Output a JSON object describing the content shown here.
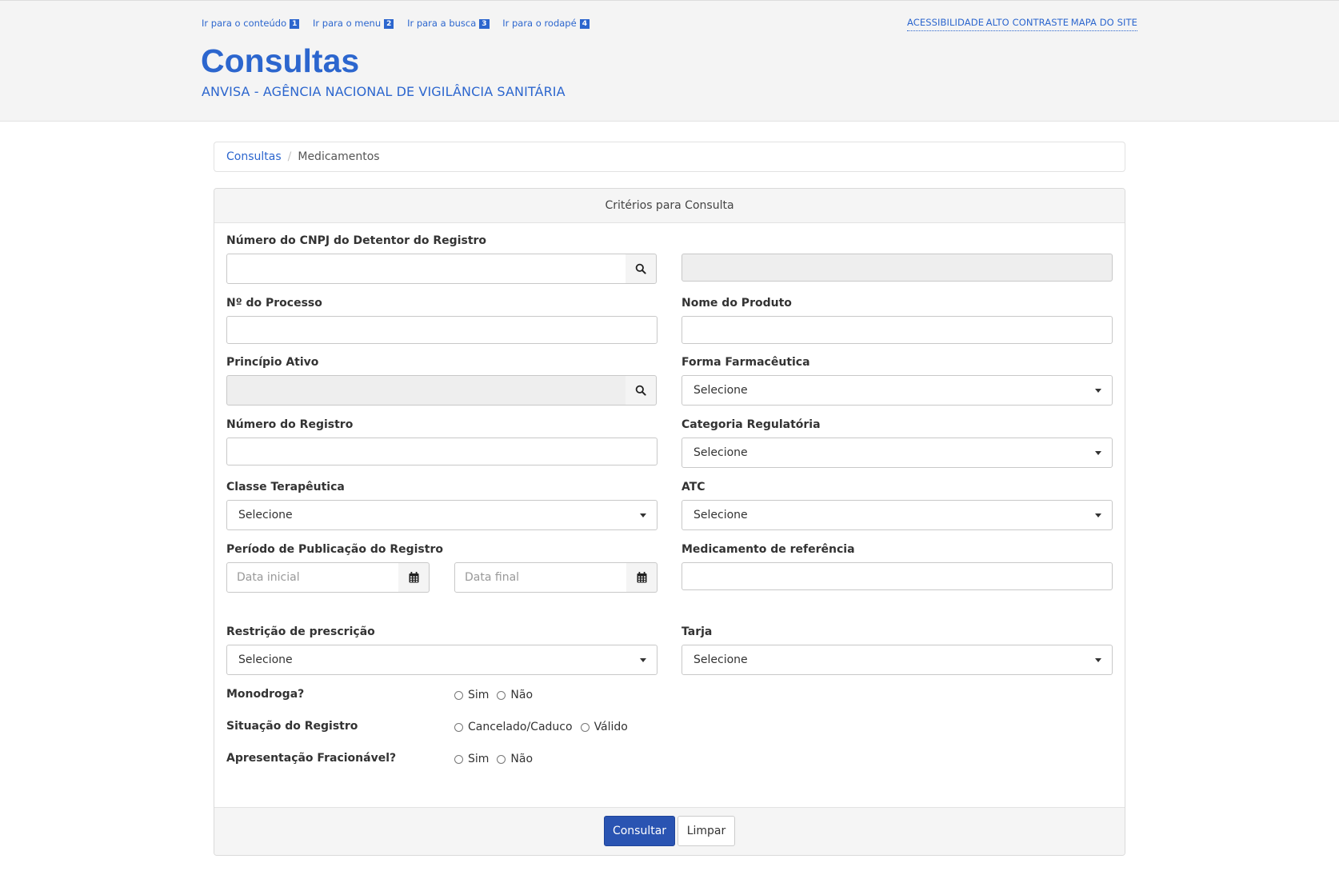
{
  "header": {
    "skip_links": [
      {
        "label": "Ir para o conteúdo",
        "num": "1"
      },
      {
        "label": "Ir para o menu",
        "num": "2"
      },
      {
        "label": "Ir para a busca",
        "num": "3"
      },
      {
        "label": "Ir para o rodapé",
        "num": "4"
      }
    ],
    "top_links": [
      "ACESSIBILIDADE",
      "ALTO CONTRASTE",
      "MAPA DO SITE"
    ],
    "title": "Consultas",
    "subtitle": "ANVISA - AGÊNCIA NACIONAL DE VIGILÂNCIA SANITÁRIA"
  },
  "breadcrumb": {
    "root": "Consultas",
    "separator": "/",
    "current": "Medicamentos"
  },
  "panel": {
    "heading": "Critérios para Consulta"
  },
  "form": {
    "cnpj": {
      "label": "Número do CNPJ do Detentor do Registro",
      "value": "",
      "icon": "search-icon"
    },
    "cnpj_result": {
      "value": ""
    },
    "processo": {
      "label": "Nº do Processo",
      "value": ""
    },
    "nome_produto": {
      "label": "Nome do Produto",
      "value": ""
    },
    "principio_ativo": {
      "label": "Princípio Ativo",
      "value": "",
      "icon": "search-icon"
    },
    "forma_farmaceutica": {
      "label": "Forma Farmacêutica",
      "selected": "Selecione"
    },
    "numero_registro": {
      "label": "Número do Registro",
      "value": ""
    },
    "categoria_regulatoria": {
      "label": "Categoria Regulatória",
      "selected": "Selecione"
    },
    "classe_terapeutica": {
      "label": "Classe Terapêutica",
      "selected": "Selecione"
    },
    "atc": {
      "label": "ATC",
      "selected": "Selecione"
    },
    "periodo": {
      "label": "Período de Publicação do Registro",
      "data_inicial_placeholder": "Data inicial",
      "data_final_placeholder": "Data final",
      "icon": "calendar-icon"
    },
    "medicamento_referencia": {
      "label": "Medicamento de referência",
      "value": ""
    },
    "restricao_prescricao": {
      "label": "Restrição de prescrição",
      "selected": "Selecione"
    },
    "tarja": {
      "label": "Tarja",
      "selected": "Selecione"
    },
    "monodroga": {
      "label": "Monodroga?",
      "options": [
        "Sim",
        "Não"
      ]
    },
    "situacao_registro": {
      "label": "Situação do Registro",
      "options": [
        "Cancelado/Caduco",
        "Válido"
      ]
    },
    "apresentacao_fracionavel": {
      "label": "Apresentação Fracionável?",
      "options": [
        "Sim",
        "Não"
      ]
    }
  },
  "buttons": {
    "consultar": "Consultar",
    "limpar": "Limpar"
  },
  "colors": {
    "brand_blue": "#2c66ce",
    "primary_button": "#2a54b2",
    "header_bg": "#f4f4f4",
    "disabled_field": "#eeeeee"
  }
}
